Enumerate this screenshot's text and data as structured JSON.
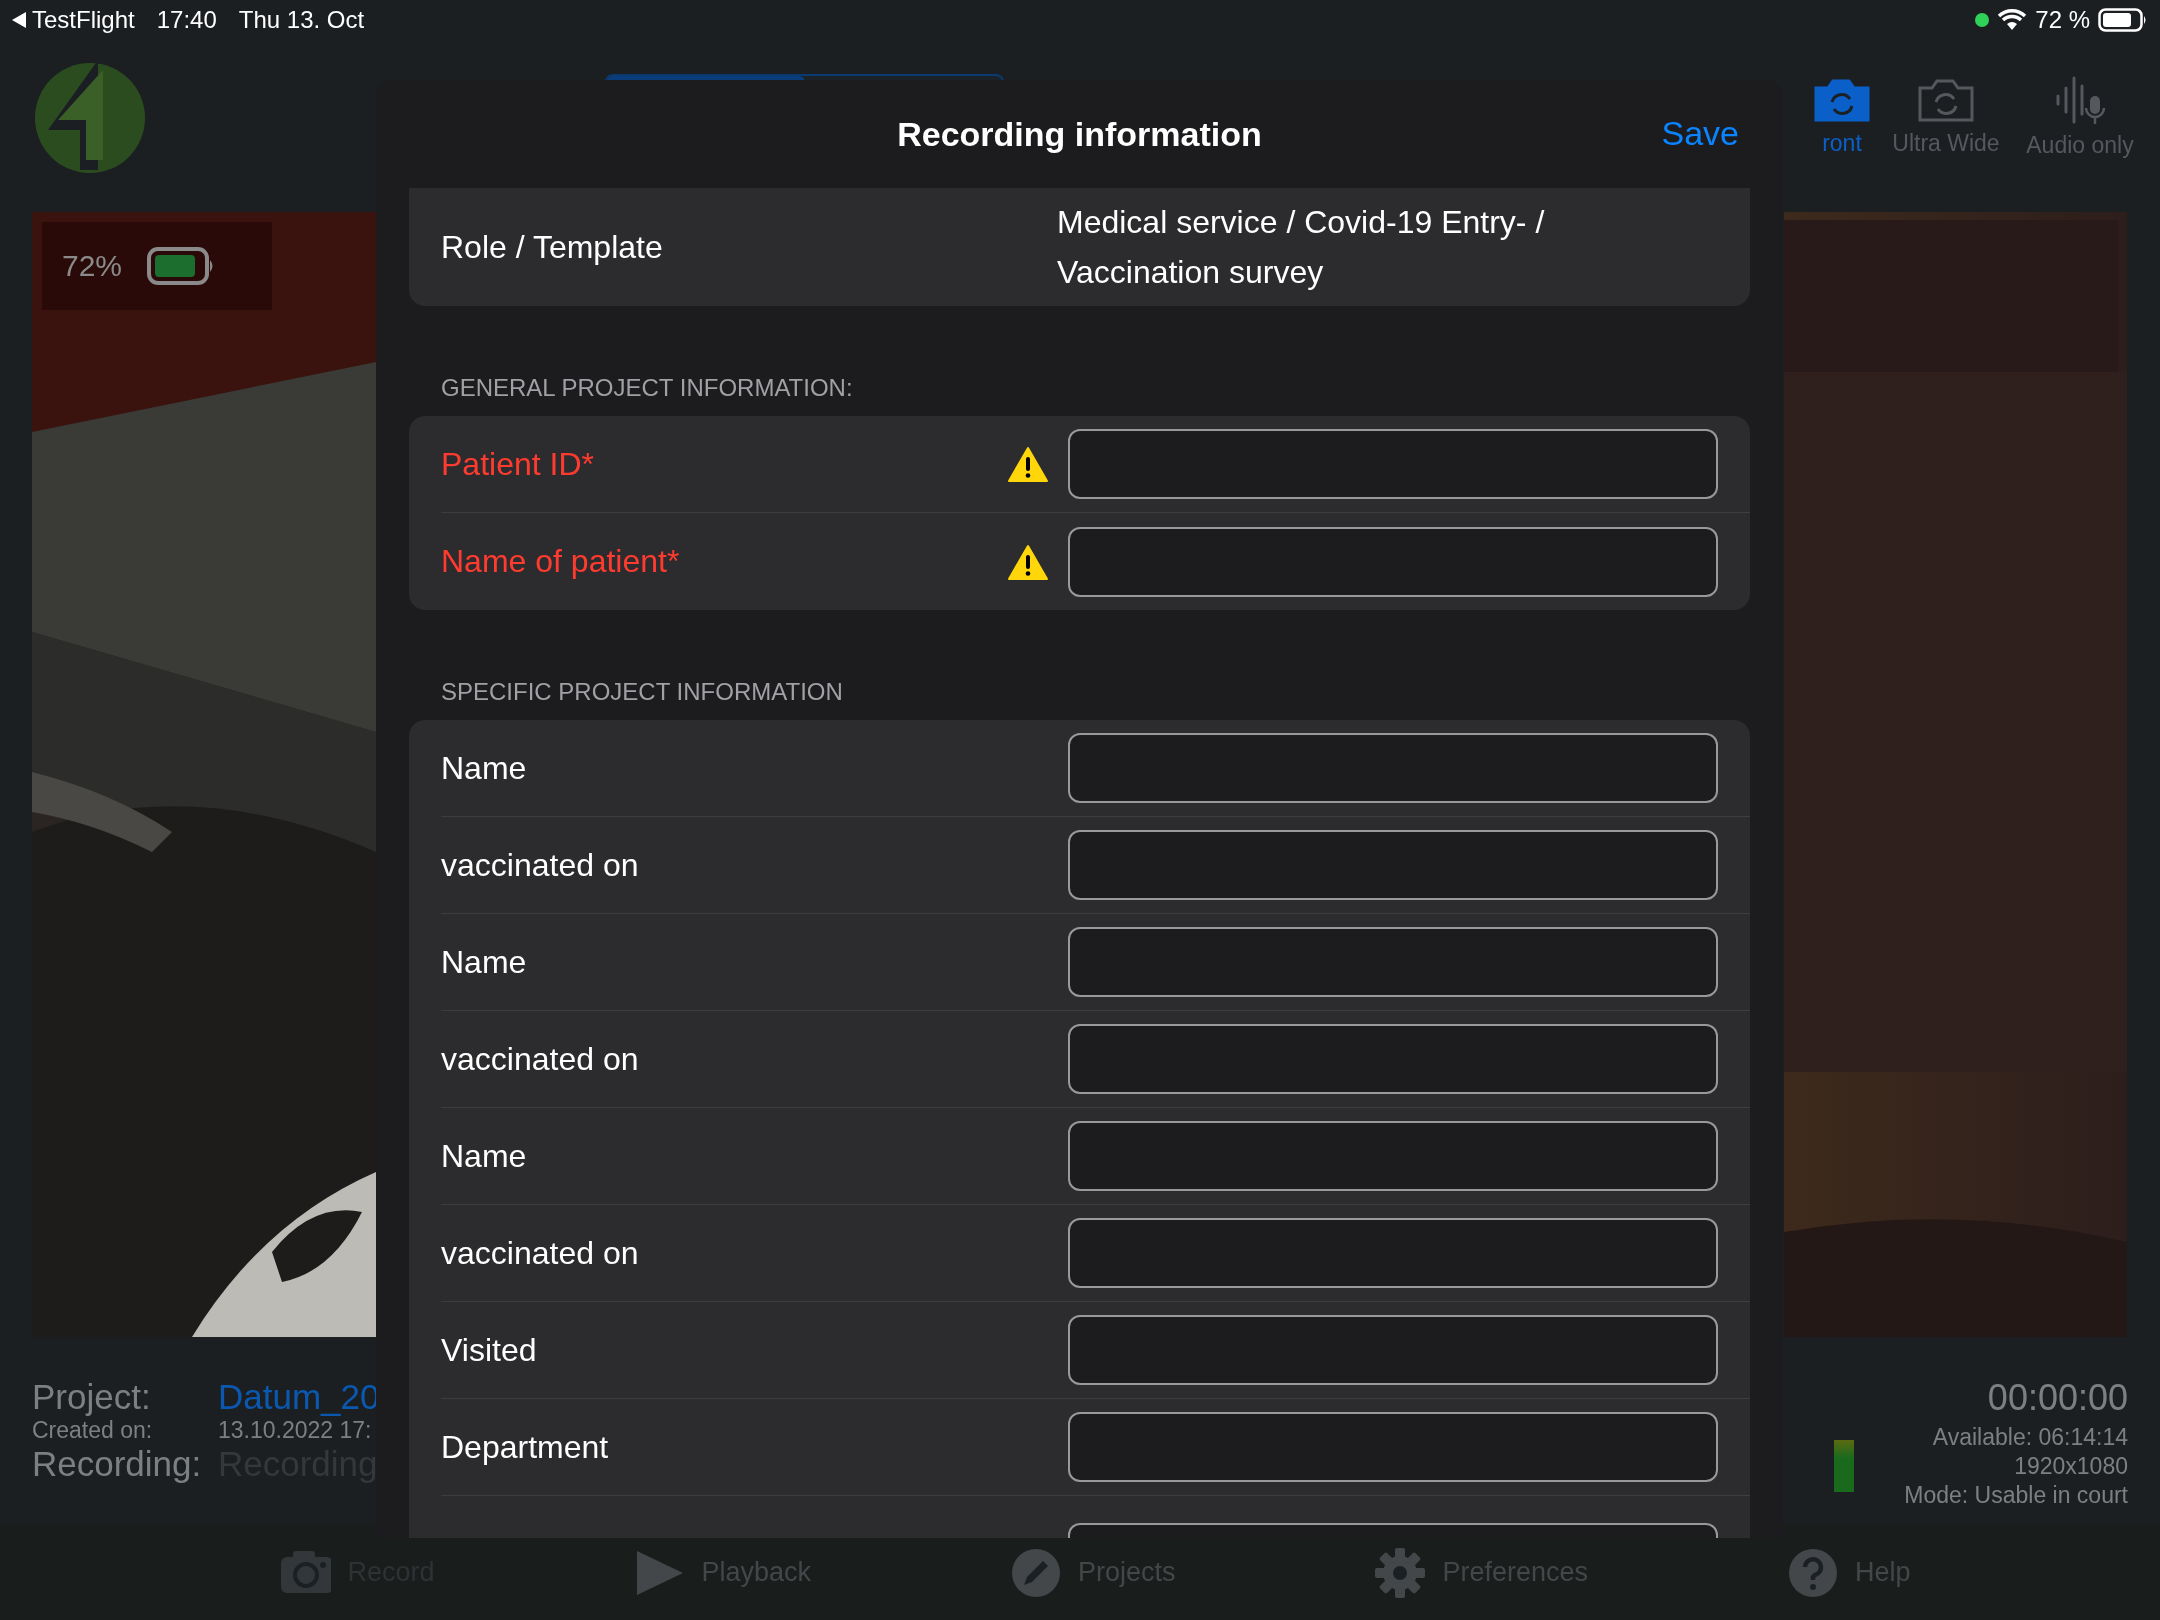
{
  "status_bar": {
    "back_app": "TestFlight",
    "time": "17:40",
    "date": "Thu 13. Oct",
    "battery": "72 %"
  },
  "camera_modes": [
    {
      "label": "ront",
      "kind": "camera",
      "selected": true
    },
    {
      "label": "Ultra Wide",
      "kind": "camera",
      "selected": false
    },
    {
      "label": "Audio only",
      "kind": "audio",
      "selected": false
    }
  ],
  "preview_battery": {
    "reading": "72%"
  },
  "project_info": [
    {
      "label": "Project:",
      "value": "Datum_20",
      "kind": "link"
    },
    {
      "label": "Created on:",
      "value": "13.10.2022 17:",
      "kind": "small"
    },
    {
      "label": "Recording:",
      "value": "Recording",
      "kind": "placeholder"
    }
  ],
  "recording_status": {
    "timer": "00:00:00",
    "lines": [
      "Available: 06:14:14",
      "1920x1080",
      "Mode: Usable in court"
    ]
  },
  "tab_bar": [
    {
      "label": "Record",
      "disabled": true
    },
    {
      "label": "Playback",
      "disabled": false
    },
    {
      "label": "Projects",
      "disabled": false
    },
    {
      "label": "Preferences",
      "disabled": false
    },
    {
      "label": "Help",
      "disabled": false
    }
  ],
  "dialog": {
    "title": "Recording information",
    "save": "Save",
    "role_label": "Role / Template",
    "role_value": "Medical service / Covid-19 Entry- / Vaccination survey",
    "sections": [
      {
        "header": "GENERAL PROJECT INFORMATION:",
        "fields": [
          {
            "label": "Patient ID*",
            "required": true
          },
          {
            "label": "Name of patient*",
            "required": true
          }
        ]
      },
      {
        "header": "SPECIFIC PROJECT INFORMATION",
        "fields": [
          {
            "label": "Name",
            "required": false
          },
          {
            "label": "vaccinated on",
            "required": false
          },
          {
            "label": "Name",
            "required": false
          },
          {
            "label": "vaccinated on",
            "required": false
          },
          {
            "label": "Name",
            "required": false
          },
          {
            "label": "vaccinated on",
            "required": false
          },
          {
            "label": "Visited",
            "required": false
          },
          {
            "label": "Department",
            "required": false
          },
          {
            "kind": "cut_off"
          }
        ]
      }
    ]
  }
}
